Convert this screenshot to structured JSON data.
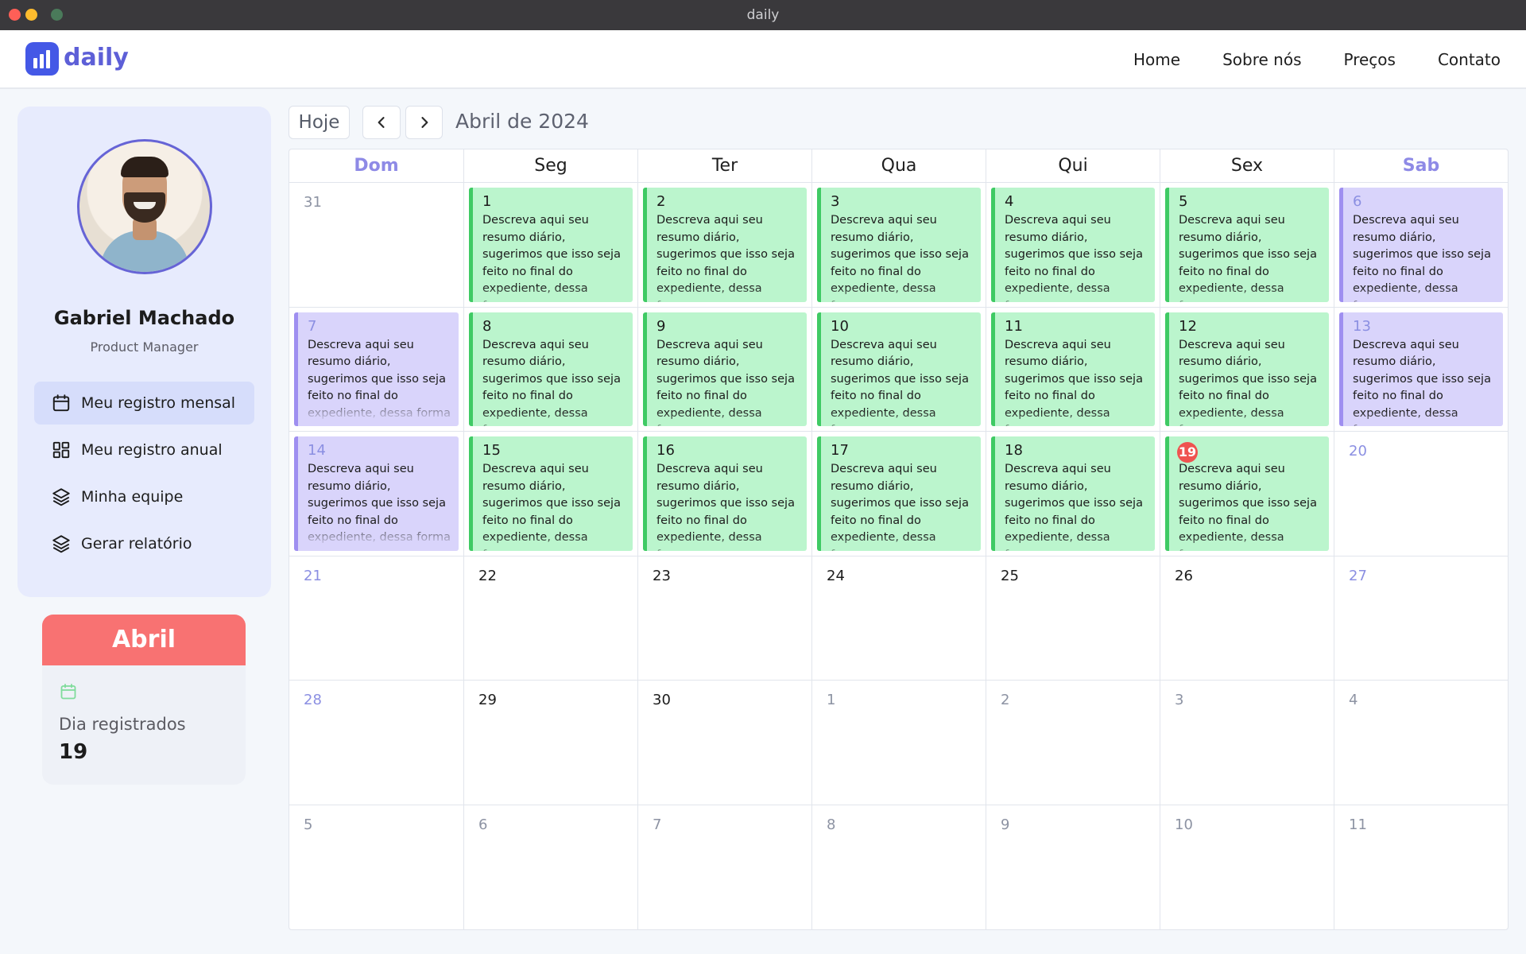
{
  "window": {
    "title": "daily"
  },
  "nav": {
    "brand": "daily",
    "links": [
      "Home",
      "Sobre nós",
      "Preços",
      "Contato"
    ]
  },
  "profile": {
    "name": "Gabriel Machado",
    "role": "Product Manager"
  },
  "menu": [
    {
      "label": "Meu registro mensal",
      "icon": "calendar-icon",
      "active": true
    },
    {
      "label": "Meu registro anual",
      "icon": "grid-icon",
      "active": false
    },
    {
      "label": "Minha equipe",
      "icon": "layers-icon",
      "active": false
    },
    {
      "label": "Gerar relatório",
      "icon": "layers-icon",
      "active": false
    }
  ],
  "month_card": {
    "month": "Abril",
    "label": "Dia registrados",
    "value": "19"
  },
  "toolbar": {
    "today_label": "Hoje",
    "current_month": "Abril de 2024"
  },
  "calendar": {
    "weekdays": [
      "Dom",
      "Seg",
      "Ter",
      "Qua",
      "Qui",
      "Sex",
      "Sab"
    ],
    "note_text": "Descreva aqui seu resumo diário, sugerimos que isso seja feito no final do expediente, dessa forma",
    "today": 19,
    "colors": {
      "weekday_entry": "#bbf5cd",
      "weekend_entry": "#d9d4fb",
      "today_badge": "#ef5350"
    },
    "days": [
      {
        "day": 31,
        "current": false,
        "entry": false
      },
      {
        "day": 1,
        "current": true,
        "entry": true
      },
      {
        "day": 2,
        "current": true,
        "entry": true
      },
      {
        "day": 3,
        "current": true,
        "entry": true
      },
      {
        "day": 4,
        "current": true,
        "entry": true
      },
      {
        "day": 5,
        "current": true,
        "entry": true
      },
      {
        "day": 6,
        "current": true,
        "entry": true
      },
      {
        "day": 7,
        "current": true,
        "entry": true
      },
      {
        "day": 8,
        "current": true,
        "entry": true
      },
      {
        "day": 9,
        "current": true,
        "entry": true
      },
      {
        "day": 10,
        "current": true,
        "entry": true
      },
      {
        "day": 11,
        "current": true,
        "entry": true
      },
      {
        "day": 12,
        "current": true,
        "entry": true
      },
      {
        "day": 13,
        "current": true,
        "entry": true
      },
      {
        "day": 14,
        "current": true,
        "entry": true
      },
      {
        "day": 15,
        "current": true,
        "entry": true
      },
      {
        "day": 16,
        "current": true,
        "entry": true
      },
      {
        "day": 17,
        "current": true,
        "entry": true
      },
      {
        "day": 18,
        "current": true,
        "entry": true
      },
      {
        "day": 19,
        "current": true,
        "entry": true
      },
      {
        "day": 20,
        "current": true,
        "entry": false
      },
      {
        "day": 21,
        "current": true,
        "entry": false
      },
      {
        "day": 22,
        "current": true,
        "entry": false
      },
      {
        "day": 23,
        "current": true,
        "entry": false
      },
      {
        "day": 24,
        "current": true,
        "entry": false
      },
      {
        "day": 25,
        "current": true,
        "entry": false
      },
      {
        "day": 26,
        "current": true,
        "entry": false
      },
      {
        "day": 27,
        "current": true,
        "entry": false
      },
      {
        "day": 28,
        "current": true,
        "entry": false
      },
      {
        "day": 29,
        "current": true,
        "entry": false
      },
      {
        "day": 30,
        "current": true,
        "entry": false
      },
      {
        "day": 1,
        "current": false,
        "entry": false
      },
      {
        "day": 2,
        "current": false,
        "entry": false
      },
      {
        "day": 3,
        "current": false,
        "entry": false
      },
      {
        "day": 4,
        "current": false,
        "entry": false
      },
      {
        "day": 5,
        "current": false,
        "entry": false
      },
      {
        "day": 6,
        "current": false,
        "entry": false
      },
      {
        "day": 7,
        "current": false,
        "entry": false
      },
      {
        "day": 8,
        "current": false,
        "entry": false
      },
      {
        "day": 9,
        "current": false,
        "entry": false
      },
      {
        "day": 10,
        "current": false,
        "entry": false
      },
      {
        "day": 11,
        "current": false,
        "entry": false
      }
    ]
  }
}
